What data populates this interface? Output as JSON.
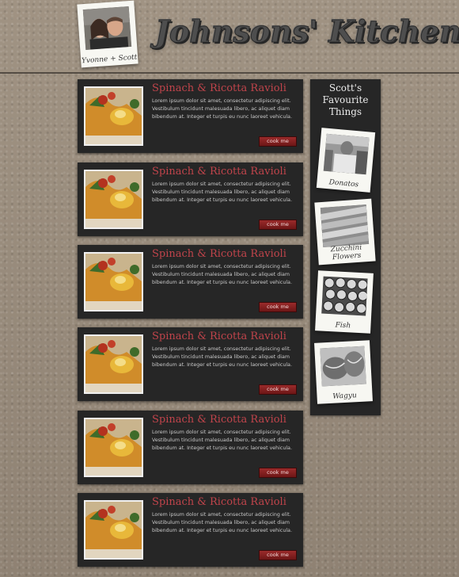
{
  "header": {
    "site_title": "Johnsons' Kitchen",
    "profile_caption": "Yvonne + Scott"
  },
  "recipes": [
    {
      "title": "Spinach & Ricotta Ravioli",
      "description": "Lorem ipsum dolor sit amet, consectetur adipiscing elit. Vestibulum tincidunt malesuada libero, ac aliquet diam bibendum at. Integer et turpis eu nunc laoreet vehicula.",
      "button": "cook me"
    },
    {
      "title": "Spinach & Ricotta Ravioli",
      "description": "Lorem ipsum dolor sit amet, consectetur adipiscing elit. Vestibulum tincidunt malesuada libero, ac aliquet diam bibendum at. Integer et turpis eu nunc laoreet vehicula.",
      "button": "cook me"
    },
    {
      "title": "Spinach & Ricotta Ravioli",
      "description": "Lorem ipsum dolor sit amet, consectetur adipiscing elit. Vestibulum tincidunt malesuada libero, ac aliquet diam bibendum at. Integer et turpis eu nunc laoreet vehicula.",
      "button": "cook me"
    },
    {
      "title": "Spinach & Ricotta Ravioli",
      "description": "Lorem ipsum dolor sit amet, consectetur adipiscing elit. Vestibulum tincidunt malesuada libero, ac aliquet diam bibendum at. Integer et turpis eu nunc laoreet vehicula.",
      "button": "cook me"
    },
    {
      "title": "Spinach & Ricotta Ravioli",
      "description": "Lorem ipsum dolor sit amet, consectetur adipiscing elit. Vestibulum tincidunt malesuada libero, ac aliquet diam bibendum at. Integer et turpis eu nunc laoreet vehicula.",
      "button": "cook me"
    },
    {
      "title": "Spinach & Ricotta Ravioli",
      "description": "Lorem ipsum dolor sit amet, consectetur adipiscing elit. Vestibulum tincidunt malesuada libero, ac aliquet diam bibendum at. Integer et turpis eu nunc laoreet vehicula.",
      "button": "cook me"
    }
  ],
  "sidebar": {
    "title": "Scott's Favourite Things",
    "items": [
      {
        "caption": "Donatos"
      },
      {
        "caption": "Zucchini Flowers"
      },
      {
        "caption": "Fish"
      },
      {
        "caption": "Wagyu"
      }
    ]
  }
}
